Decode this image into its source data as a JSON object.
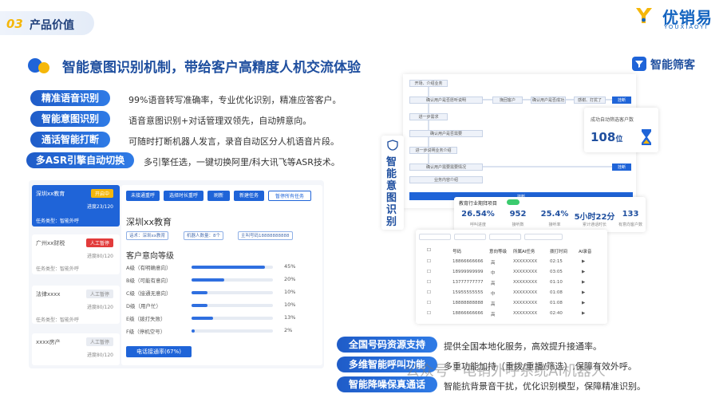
{
  "section": {
    "number": "03",
    "title": "产品价值"
  },
  "brand": {
    "name": "优销易",
    "sub": "YOUXIAOYI"
  },
  "headline": "智能意图识别机制，带给客户高精度人机交流体验",
  "corner_label": "智能筛客",
  "features": [
    {
      "label": "精准语音识别",
      "desc": "99%语音转写准确率，专业优化识别，精准应答客户。"
    },
    {
      "label": "智能意图识别",
      "desc": "语音意图识别+对话管理双领先，自动辨意向。"
    },
    {
      "label": "通话智能打断",
      "desc": "可随时打断机器人发言，录音自动区分人机语音片段。"
    },
    {
      "label": "多ASR引擎自动切换",
      "desc": "多引擎任选，一键切换阿里/科大讯飞等ASR技术。"
    }
  ],
  "bottom_features": [
    {
      "label": "全国号码资源支持",
      "desc": "提供全国本地化服务，高效提升接通率。"
    },
    {
      "label": "多维智能呼叫功能",
      "desc": "多重功能加持（重拨/重播/筛选）,保障有效外呼。"
    },
    {
      "label": "智能降噪保真通话",
      "desc": "智能抗背景音干扰，优化识别模型，保障精准识别。"
    }
  ],
  "watermark": "公众号 · 电销外呼系统AI机器人",
  "left_panel": {
    "tasks": [
      {
        "name": "深圳xx教育",
        "badge": "开启中",
        "progress": "进度23/120",
        "type": "任务类型：智能外呼"
      },
      {
        "name": "广州xx财税",
        "badge": "人工暂停",
        "progress": "进度80/120",
        "type": "任务类型：智能外呼"
      },
      {
        "name": "法律xxxx",
        "badge": "人工暂停",
        "progress": "进度80/120",
        "type": "任务类型：智能外呼"
      },
      {
        "name": "xxxx房产",
        "badge": "人工暂停",
        "progress": "进度80/120",
        "type": ""
      }
    ],
    "toolbar": [
      "未接通重呼",
      "选择时长重呼",
      "刷新",
      "新建任务",
      "暂停所有任务"
    ],
    "detail_name": "深圳xx教育",
    "tags": [
      "话术：深圳xx教育",
      "机器人数量：8个",
      "主叫号码18888888888"
    ],
    "levels_title": "客户意向等级",
    "levels": [
      {
        "label": "A级（有明确意向）",
        "pct": "45%",
        "value": 45
      },
      {
        "label": "B级（可能有意向）",
        "pct": "20%",
        "value": 20
      },
      {
        "label": "C级（接通无意向）",
        "pct": "10%",
        "value": 10
      },
      {
        "label": "D级（用户忙）",
        "pct": "10%",
        "value": 10
      },
      {
        "label": "E级（拨打失败）",
        "pct": "13%",
        "value": 13
      },
      {
        "label": "F级（停机空号）",
        "pct": "2%",
        "value": 2
      }
    ],
    "rate_button": "电话接通率(67%)"
  },
  "flow": {
    "vertical_title": [
      "智",
      "能",
      "意",
      "图",
      "识",
      "别"
    ],
    "boxes": [
      "开场、介绍业务",
      "确认用户是否愿听说明",
      "挽回客户",
      "确认用户是否成功",
      "感谢、打扰了",
      "挂断",
      "进一步需求",
      "确认用户是否需要",
      "进一步说明业务介绍",
      "确认用户需要需要情况",
      "挂断",
      "业务内容介绍"
    ],
    "stat_label": "成功自动筛选客户数",
    "stat_value": "108",
    "stat_unit": "位"
  },
  "kpis": {
    "title": "教育行业期拜项目",
    "items": [
      {
        "value": "26.54%",
        "label": "呼叫进度"
      },
      {
        "value": "952",
        "label": "接听数"
      },
      {
        "value": "25.4%",
        "label": "接听率"
      },
      {
        "value": "5小时22分",
        "label": "累计通话时长"
      },
      {
        "value": "133",
        "label": "有意向客户数"
      }
    ]
  },
  "table": {
    "headers": [
      "号码",
      "意向等级",
      "所属AI任务",
      "拨打时间",
      "AI录音"
    ],
    "rows": [
      [
        "18866666666",
        "高",
        "XXXXXXXX",
        "02:15"
      ],
      [
        "18999999999",
        "中",
        "XXXXXXXX",
        "03:05"
      ],
      [
        "13777777777",
        "高",
        "XXXXXXXX",
        "01:10"
      ],
      [
        "15955555555",
        "中",
        "XXXXXXXX",
        "01:08"
      ],
      [
        "18888888888",
        "高",
        "XXXXXXXX",
        "01:08"
      ],
      [
        "18866666666",
        "高",
        "XXXXXXXX",
        "02:40"
      ]
    ]
  },
  "colors": {
    "primary": "#1f64d8",
    "accent": "#f5b70a",
    "title": "#1f4f9f"
  }
}
